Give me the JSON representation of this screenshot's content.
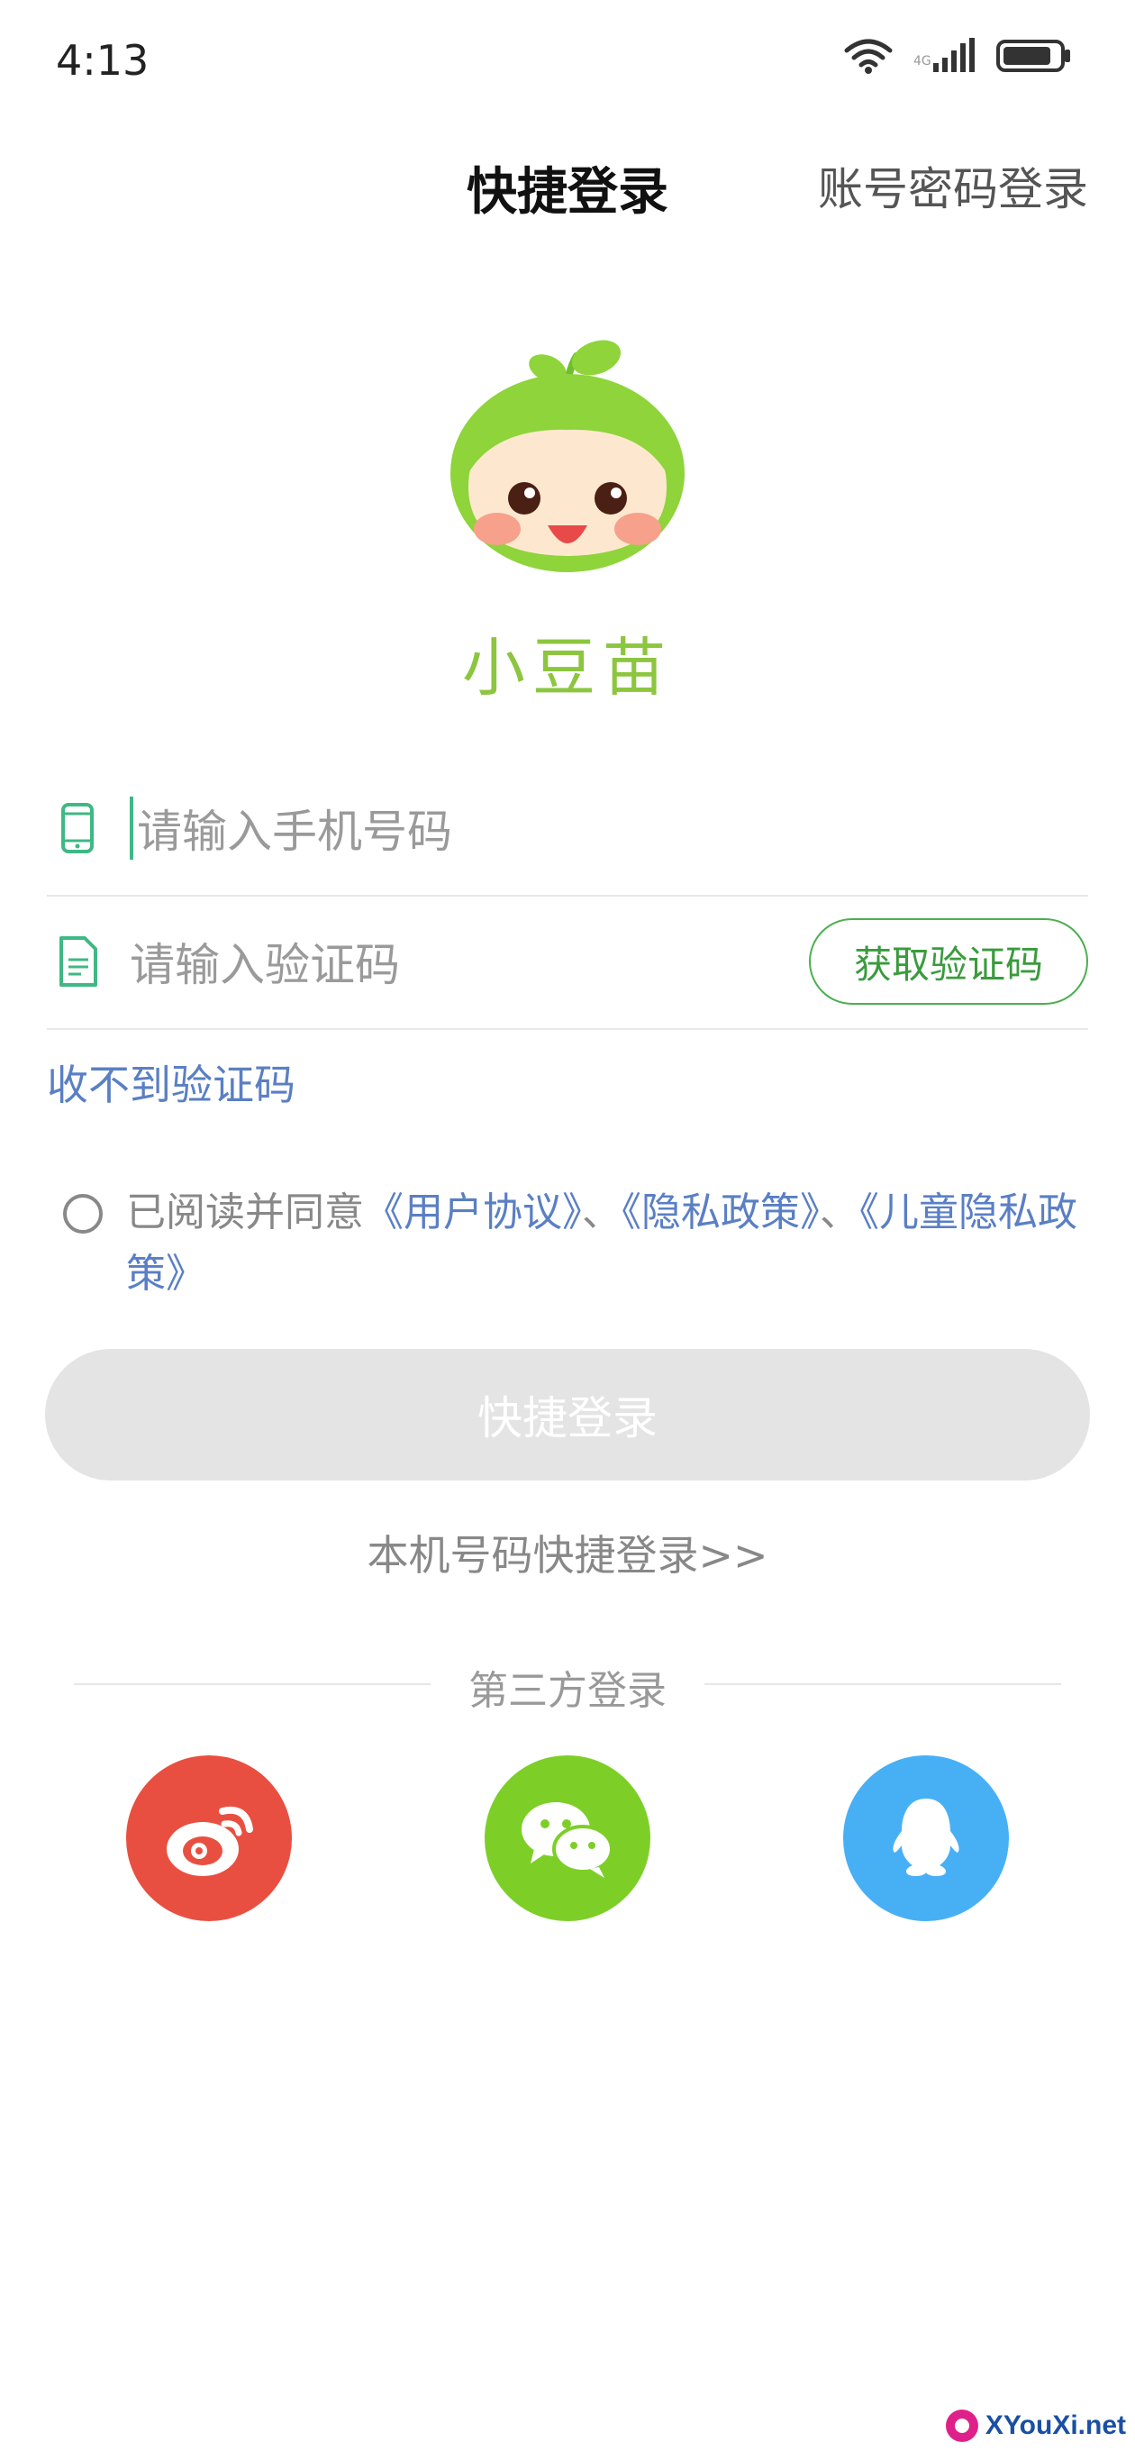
{
  "status_bar": {
    "time": "4:13"
  },
  "header": {
    "title": "快捷登录",
    "alt_login": "账号密码登录"
  },
  "brand": {
    "name": "小豆苗"
  },
  "form": {
    "phone_placeholder": "请输入手机号码",
    "code_placeholder": "请输入验证码",
    "get_code_label": "获取验证码",
    "no_code_label": "收不到验证码"
  },
  "agreement": {
    "prefix": "已阅读并同意",
    "user_agreement": "《用户协议》",
    "separator1": "、",
    "privacy_policy": "《隐私政策》",
    "separator2": "、",
    "child_privacy_policy": "《儿童隐私政策》",
    "checked": false
  },
  "login_button": {
    "label": "快捷登录"
  },
  "local_login": {
    "label": "本机号码快捷登录>>"
  },
  "third_party": {
    "label": "第三方登录",
    "providers": [
      {
        "name": "weibo",
        "icon": "weibo-icon",
        "color": "#e94f40"
      },
      {
        "name": "wechat",
        "icon": "wechat-icon",
        "color": "#7dcf27"
      },
      {
        "name": "qq",
        "icon": "qq-icon",
        "color": "#47b0f5"
      }
    ]
  },
  "watermark": {
    "text": "XYouXi.net"
  },
  "colors": {
    "brand_green": "#8cc63f",
    "link_blue": "#5a7fc4",
    "button_disabled": "#e4e4e4"
  }
}
